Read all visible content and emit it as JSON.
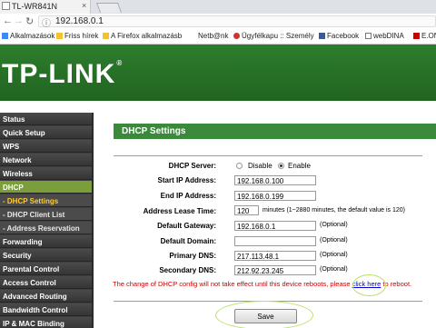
{
  "browser": {
    "tab_title": "TL-WR841N",
    "close_glyph": "×",
    "url": "192.168.0.1",
    "back_glyph": "←",
    "forward_glyph": "→",
    "reload_glyph": "↻",
    "info_glyph": "ⓘ",
    "bookmarks": [
      {
        "label": "Alkalmazások",
        "icon": "apps-grid-icon",
        "color": "#4285f4"
      },
      {
        "label": "Friss hírek",
        "icon": "bookmark-icon",
        "color": "#f1c232"
      },
      {
        "label": "A Firefox alkalmazásb",
        "icon": "bookmark-icon",
        "color": "#f1c232"
      },
      {
        "label": "Netb@nk",
        "icon": "bookmark-icon",
        "color": "#ffffff"
      },
      {
        "label": "Ügyfélkapu :: Személy",
        "icon": "bookmark-icon",
        "color": "#cc3333"
      },
      {
        "label": "Facebook",
        "icon": "facebook-icon",
        "color": "#3b5998"
      },
      {
        "label": "webDINA",
        "icon": "page-icon",
        "color": "#ffffff"
      },
      {
        "label": "E.ON",
        "icon": "bookmark-icon",
        "color": "#cc0000"
      }
    ]
  },
  "brand": {
    "logo": "TP-LINK",
    "reg": "®"
  },
  "sidebar": {
    "items": [
      {
        "label": "Status"
      },
      {
        "label": "Quick Setup"
      },
      {
        "label": "WPS"
      },
      {
        "label": "Network"
      },
      {
        "label": "Wireless"
      },
      {
        "label": "DHCP"
      },
      {
        "label": "- DHCP Settings"
      },
      {
        "label": "- DHCP Client List"
      },
      {
        "label": "- Address Reservation"
      },
      {
        "label": "Forwarding"
      },
      {
        "label": "Security"
      },
      {
        "label": "Parental Control"
      },
      {
        "label": "Access Control"
      },
      {
        "label": "Advanced Routing"
      },
      {
        "label": "Bandwidth Control"
      },
      {
        "label": "IP & MAC Binding"
      }
    ]
  },
  "dhcp": {
    "title": "DHCP Settings",
    "server_label": "DHCP Server:",
    "disable_label": "Disable",
    "enable_label": "Enable",
    "server_selected": "Enable",
    "start_label": "Start IP Address:",
    "start_value": "192.168.0.100",
    "end_label": "End IP Address:",
    "end_value": "192.168.0.199",
    "lease_label": "Address Lease Time:",
    "lease_value": "120",
    "lease_note": "minutes (1~2880 minutes, the default value is 120)",
    "gateway_label": "Default Gateway:",
    "gateway_value": "192.168.0.1",
    "domain_label": "Default Domain:",
    "domain_value": "",
    "primary_dns_label": "Primary DNS:",
    "primary_dns_value": "217.113.48.1",
    "secondary_dns_label": "Secondary DNS:",
    "secondary_dns_value": "212.92.23.245",
    "optional": "(Optional)",
    "warning_pre": "The change of DHCP config will not take effect until this device reboots, please",
    "warning_link": "click here",
    "warning_post": "to reboot.",
    "save_label": "Save"
  }
}
